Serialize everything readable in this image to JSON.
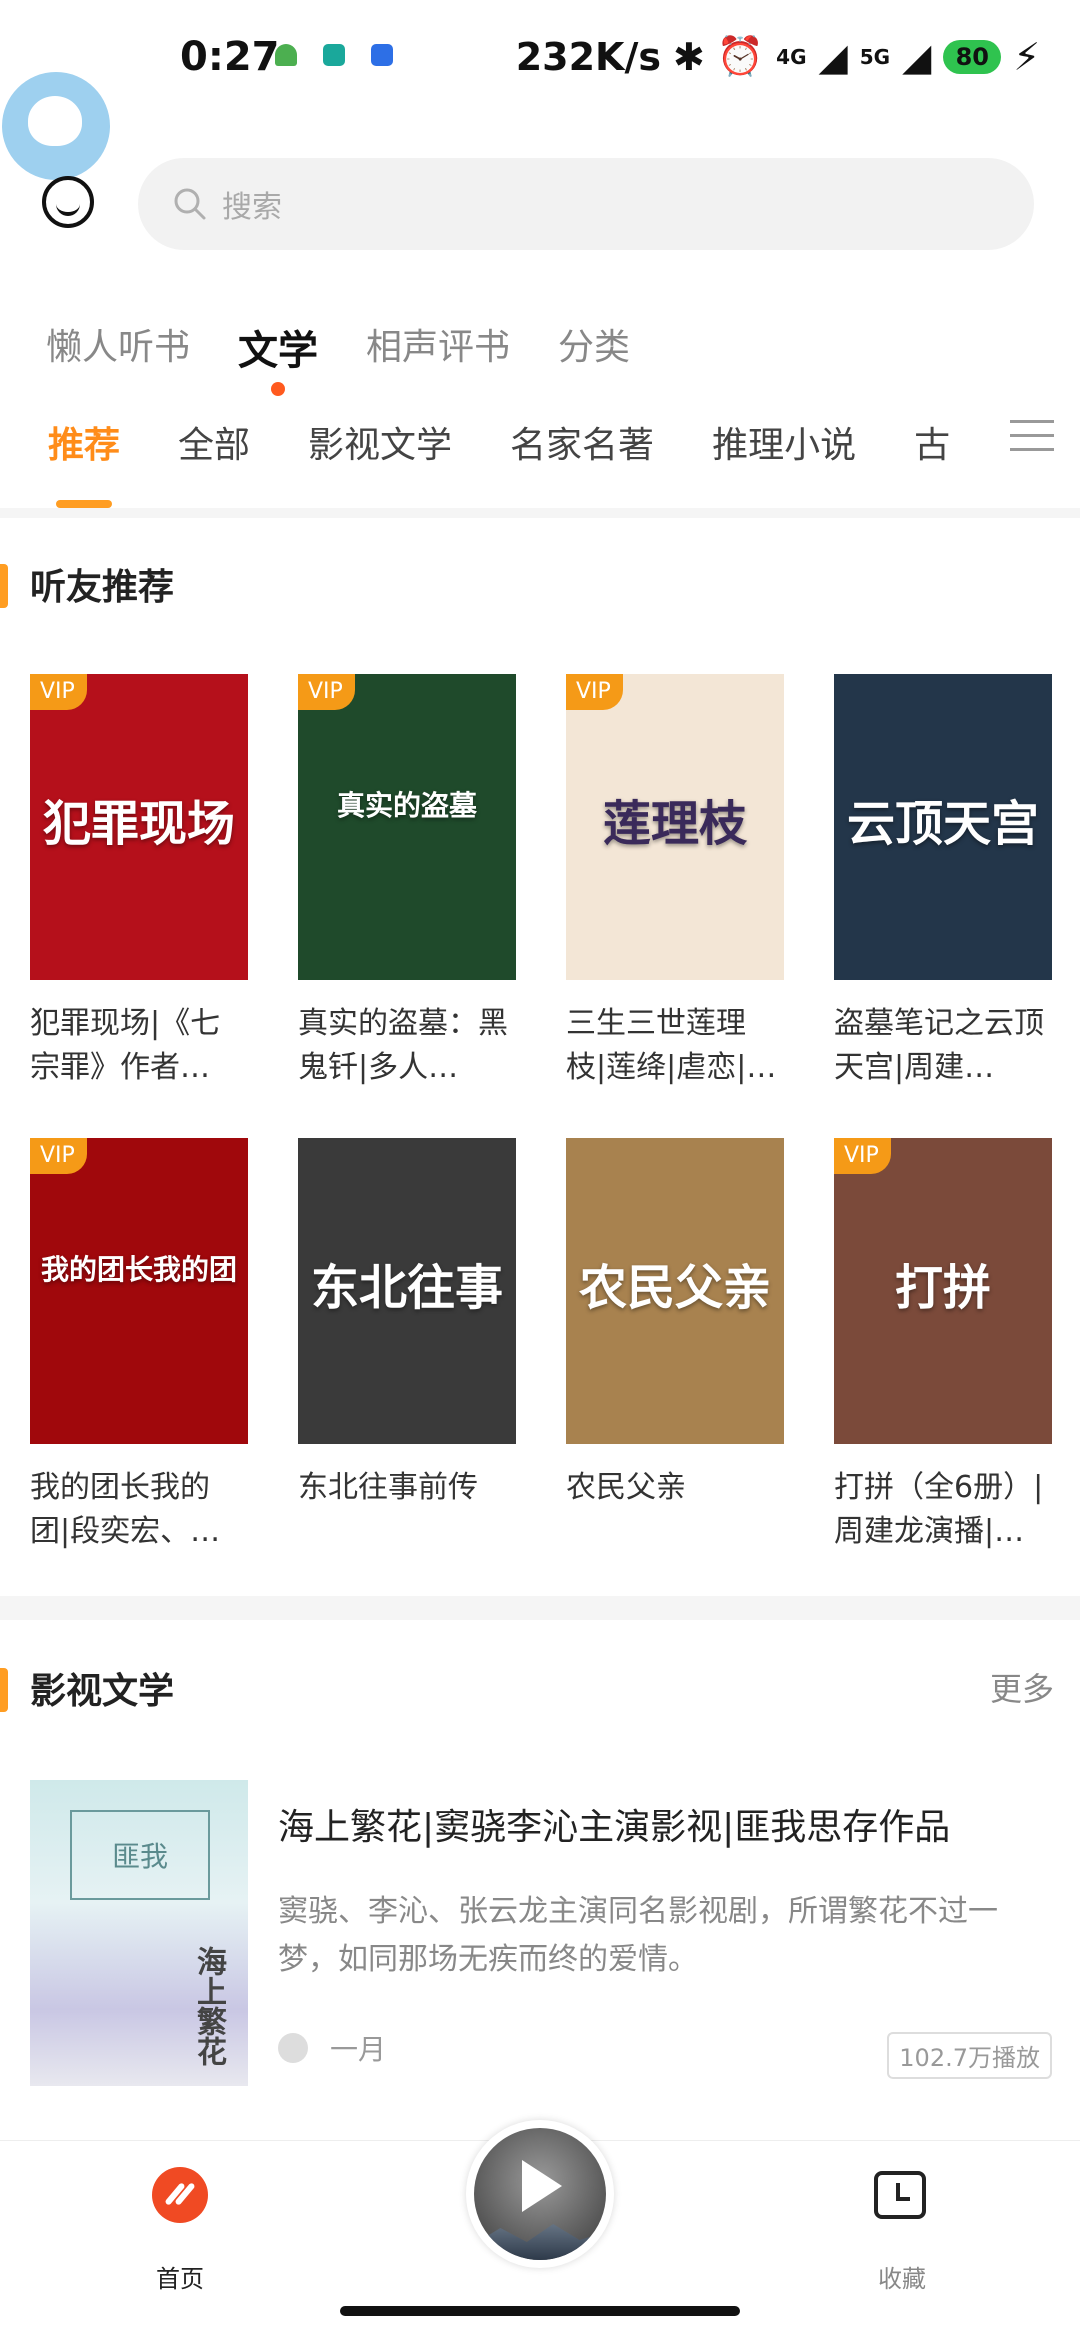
{
  "status_bar": {
    "time": "0:27",
    "net_speed": "232K/s",
    "signal1": "4G",
    "signal2": "5G",
    "battery": "80"
  },
  "search": {
    "placeholder": "搜索"
  },
  "primary_tabs": [
    "懒人听书",
    "文学",
    "相声评书",
    "分类"
  ],
  "secondary_tabs": [
    "推荐",
    "全部",
    "影视文学",
    "名家名著",
    "推理小说",
    "古"
  ],
  "section_recommend": {
    "title": "听友推荐"
  },
  "books": [
    {
      "title": "犯罪现场|《七宗罪》作者…",
      "vip": "VIP",
      "cover_text": "犯罪现场",
      "bg": "#b5101b"
    },
    {
      "title": "真实的盗墓：黑鬼钎|多人…",
      "vip": "VIP",
      "cover_text": "真实的盗墓",
      "bg": "#1f4a2b"
    },
    {
      "title": "三生三世莲理枝|莲绛|虐恋|…",
      "vip": "VIP",
      "cover_text": "莲理枝",
      "bg": "#f3e6d6"
    },
    {
      "title": "盗墓笔记之云顶天宫|周建…",
      "vip": "",
      "cover_text": "云顶天宫",
      "bg": "#23364a"
    },
    {
      "title": "我的团长我的团|段奕宏、…",
      "vip": "VIP",
      "cover_text": "我的团长我的团",
      "bg": "#a0080c"
    },
    {
      "title": "东北往事前传",
      "vip": "",
      "cover_text": "东北往事",
      "bg": "#3a3a3a"
    },
    {
      "title": "农民父亲",
      "vip": "",
      "cover_text": "农民父亲",
      "bg": "#a8824f"
    },
    {
      "title": "打拼（全6册）|周建龙演播|…",
      "vip": "VIP",
      "cover_text": "打拼",
      "bg": "#7b4a3a"
    }
  ],
  "section_film": {
    "title": "影视文学",
    "more": "更多"
  },
  "featured": {
    "title": "海上繁花|窦骁李沁主演影视|匪我思存作品",
    "desc": "窦骁、李沁、张云龙主演同名影视剧，所谓繁花不过一梦，如同那场无疾而终的爱情。",
    "author": "一月",
    "plays": "102.7万播放",
    "cover_text": "海上繁花"
  },
  "bottom_nav": {
    "home": "首页",
    "favorites": "收藏"
  },
  "colors": {
    "accent": "#ff8c19",
    "vip": "#f59a17",
    "brand_red": "#f04a23"
  }
}
